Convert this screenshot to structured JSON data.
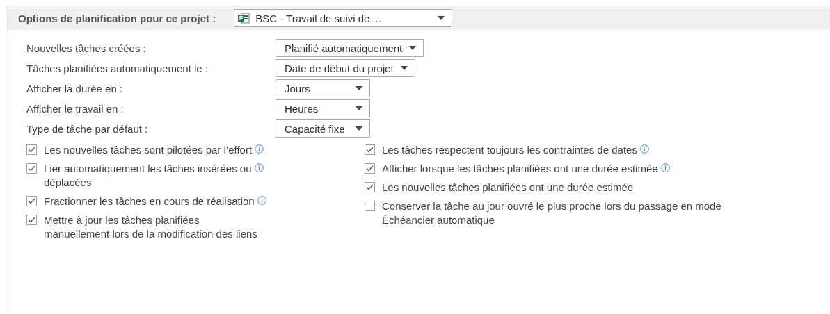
{
  "header": {
    "label": "Options de planification pour ce projet :",
    "project": "BSC - Travail de suivi de ..."
  },
  "settings": [
    {
      "label": "Nouvelles tâches créées :",
      "value": "Planifié automatiquement"
    },
    {
      "label": "Tâches planifiées automatiquement le :",
      "value": "Date de début du projet"
    },
    {
      "label": "Afficher la durée en :",
      "value": "Jours"
    },
    {
      "label": "Afficher le travail en :",
      "value": "Heures"
    },
    {
      "label": "Type de tâche par défaut :",
      "value": "Capacité fixe"
    }
  ],
  "options_left": [
    {
      "label": "Les nouvelles tâches sont pilotées par l’effort",
      "checked": true,
      "info": true
    },
    {
      "label": "Lier automatiquement les tâches insérées ou\ndéplacées",
      "checked": true,
      "info": true
    },
    {
      "label": "Fractionner les tâches en cours de réalisation",
      "checked": true,
      "info": true
    },
    {
      "label": "Mettre à jour les tâches planifiées\nmanuellement lors de la modification des liens",
      "checked": true,
      "info": false
    }
  ],
  "options_right": [
    {
      "label": "Les tâches respectent toujours les contraintes de dates",
      "checked": true,
      "info": true
    },
    {
      "label": "Afficher lorsque les tâches planifiées ont une durée estimée",
      "checked": true,
      "info": true
    },
    {
      "label": "Les nouvelles tâches planifiées ont une durée estimée",
      "checked": true,
      "info": false
    },
    {
      "label": "Conserver la tâche au jour ouvré le plus proche lors du passage en mode\nÉchéancier automatique",
      "checked": false,
      "info": false
    }
  ]
}
